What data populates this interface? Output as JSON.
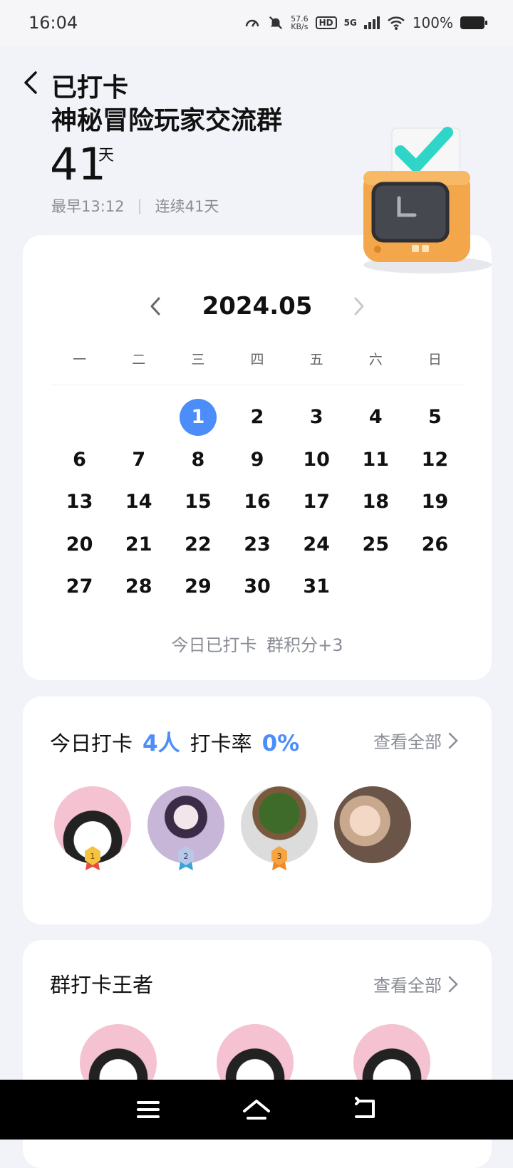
{
  "status_bar": {
    "time": "16:04",
    "net_speed_value": "57.6",
    "net_speed_unit": "KB/s",
    "hd": "HD",
    "network": "5G",
    "battery": "100%"
  },
  "header": {
    "status": "已打卡",
    "group_name": "神秘冒险玩家交流群",
    "days": "41",
    "days_unit": "天",
    "earliest": "最早13:12",
    "separator": "|",
    "streak": "连续41天"
  },
  "calendar": {
    "month": "2024.05",
    "weekdays": [
      "一",
      "二",
      "三",
      "四",
      "五",
      "六",
      "日"
    ],
    "days": [
      "",
      "",
      "1",
      "2",
      "3",
      "4",
      "5",
      "6",
      "7",
      "8",
      "9",
      "10",
      "11",
      "12",
      "13",
      "14",
      "15",
      "16",
      "17",
      "18",
      "19",
      "20",
      "21",
      "22",
      "23",
      "24",
      "25",
      "26",
      "27",
      "28",
      "29",
      "30",
      "31"
    ],
    "selected_day": "1",
    "footer": "今日已打卡 群积分+3"
  },
  "today": {
    "label": "今日打卡",
    "count": "4人",
    "rate_label": "打卡率",
    "rate": "0%",
    "view_all": "查看全部",
    "medals": [
      "1",
      "2",
      "3"
    ]
  },
  "king": {
    "title": "群打卡王者",
    "view_all": "查看全部"
  },
  "colors": {
    "accent": "#4c8dfa",
    "muted": "#8a8d96",
    "background": "#f2f3f8"
  },
  "icons": [
    "back-icon",
    "chevron-left-icon",
    "chevron-right-icon",
    "menu-icon",
    "home-icon",
    "back-nav-icon",
    "wifi-icon",
    "mute-icon"
  ]
}
